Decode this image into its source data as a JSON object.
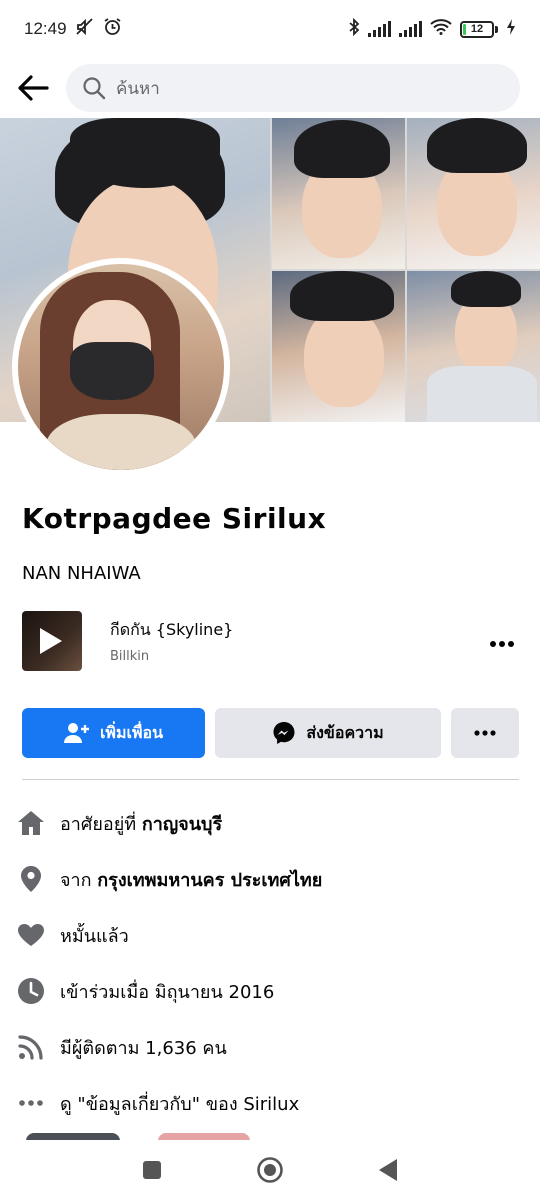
{
  "status_bar": {
    "time": "12:49",
    "battery": "12",
    "icons": [
      "mute-icon",
      "alarm-icon",
      "bluetooth-icon",
      "signal-icon",
      "signal-icon",
      "wifi-icon",
      "battery-icon",
      "charging-icon"
    ],
    "battery_color": "#34c759",
    "battery_level": 0.12
  },
  "header": {
    "search_placeholder": "ค้นหา"
  },
  "profile": {
    "name": "Kotrpagdee Sirilux",
    "nickname": "NAN NHAIWA"
  },
  "music": {
    "song": "กีดกัน {Skyline}",
    "artist": "Billkin"
  },
  "actions": {
    "add_friend": "เพิ่มเพื่อน",
    "message": "ส่งข้อความ",
    "more": "•••"
  },
  "details": {
    "lives_prefix": "อาศัยอยู่ที่ ",
    "lives_place": "กาญจนบุรี",
    "from_prefix": "จาก ",
    "from_place": "กรุงเทพมหานคร ประเทศไทย",
    "relationship": "หมั้นแล้ว",
    "joined": "เข้าร่วมเมื่อ มิถุนายน  2016",
    "followers": "มีผู้ติดตาม 1,636 คน",
    "about": "ดู \"ข้อมูลเกี่ยวกับ\" ของ Sirilux"
  },
  "colors": {
    "accent": "#1877f2",
    "secondary_button": "#e4e6eb",
    "icon_gray": "#65676b"
  }
}
